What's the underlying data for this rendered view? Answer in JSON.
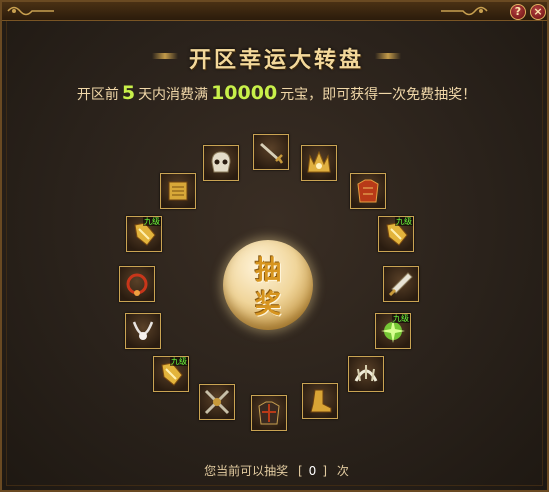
{
  "window": {
    "help_label": "?",
    "close_label": "×"
  },
  "heading": "开区幸运大转盘",
  "desc": {
    "prefix": "开区前",
    "days": "5",
    "middle": "天内消费满",
    "amount": "10000",
    "suffix": "元宝，即可获得一次免费抽奖！"
  },
  "draw_button": {
    "line1": "抽",
    "line2": "奖"
  },
  "footer": {
    "prefix": "您当前可以抽奖",
    "bracket_open": "[",
    "count": "0",
    "bracket_close": "]",
    "suffix": "次"
  },
  "prizes": [
    {
      "name": "sword",
      "tag": ""
    },
    {
      "name": "crown-helmet",
      "tag": ""
    },
    {
      "name": "red-armor",
      "tag": ""
    },
    {
      "name": "gold-gauntlet",
      "tag": "九级"
    },
    {
      "name": "dagger",
      "tag": ""
    },
    {
      "name": "green-gem",
      "tag": "九级"
    },
    {
      "name": "white-claw",
      "tag": ""
    },
    {
      "name": "gold-boots",
      "tag": ""
    },
    {
      "name": "dark-armor",
      "tag": ""
    },
    {
      "name": "crossed-blades",
      "tag": ""
    },
    {
      "name": "gold-gauntlet",
      "tag": "九级"
    },
    {
      "name": "silver-necklace",
      "tag": ""
    },
    {
      "name": "red-necklace",
      "tag": ""
    },
    {
      "name": "gold-gauntlet",
      "tag": "九级"
    },
    {
      "name": "gold-scroll",
      "tag": ""
    },
    {
      "name": "skull-helmet",
      "tag": ""
    }
  ]
}
